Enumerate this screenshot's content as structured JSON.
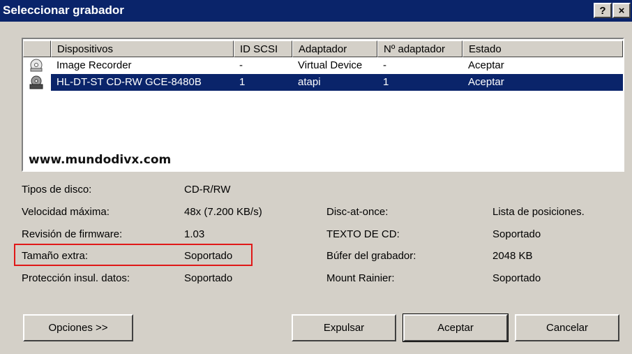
{
  "window": {
    "title": "Seleccionar grabador",
    "help_button": "?",
    "close_button": "×"
  },
  "devices": {
    "columns": [
      "Dispositivos",
      "ID SCSI",
      "Adaptador",
      "Nº adaptador",
      "Estado"
    ],
    "rows": [
      {
        "icon": "image-recorder-icon",
        "name": "Image Recorder",
        "scsi_id": "-",
        "adapter": "Virtual Device",
        "adapter_no": "-",
        "status": "Aceptar",
        "selected": false
      },
      {
        "icon": "cd-drive-icon",
        "name": "HL-DT-ST CD-RW GCE-8480B",
        "scsi_id": "1",
        "adapter": "atapi",
        "adapter_no": "1",
        "status": "Aceptar",
        "selected": true
      }
    ],
    "watermark": "www.mundodivx.com"
  },
  "info": {
    "disc_types_label": "Tipos de disco:",
    "disc_types_value": "CD-R/RW",
    "max_speed_label": "Velocidad máxima:",
    "max_speed_value": "48x (7.200 KB/s)",
    "firmware_label": "Revisión de firmware:",
    "firmware_value": "1.03",
    "extra_size_label": "Tamaño extra:",
    "extra_size_value": "Soportado",
    "protection_label": "Protección insul. datos:",
    "protection_value": "Soportado",
    "dao_label": "Disc-at-once:",
    "dao_value": "Lista de posiciones.",
    "cdtext_label": "TEXTO DE CD:",
    "cdtext_value": "Soportado",
    "buffer_label": "Búfer del grabador:",
    "buffer_value": "2048 KB",
    "mount_rainier_label": "Mount Rainier:",
    "mount_rainier_value": "Soportado"
  },
  "buttons": {
    "options": "Opciones >>",
    "eject": "Expulsar",
    "accept": "Aceptar",
    "cancel": "Cancelar"
  },
  "colors": {
    "titlebar": "#0a246a",
    "selection": "#0a246a",
    "highlight_box": "#e01818",
    "dialog_bg": "#d4d0c8"
  }
}
